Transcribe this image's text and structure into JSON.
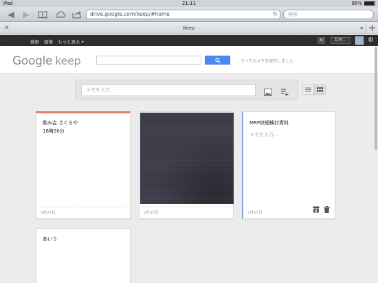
{
  "status_bar": {
    "carrier": "iPad",
    "time": "21:11",
    "battery": "98%"
  },
  "safari": {
    "url": "drive.google.com/keep/#home",
    "search_placeholder": "検索"
  },
  "tab": {
    "title": "Keep"
  },
  "google_bar": {
    "links": [
      "検索",
      "画像",
      "もっと見る ▾"
    ],
    "count": "9",
    "share_label": "共有..."
  },
  "keep_header": {
    "logo_google": "Google",
    "logo_keep": "keep",
    "saved_status": "すべてのメモを保存しました"
  },
  "note_input": {
    "placeholder": "メモを入力..."
  },
  "notes": [
    {
      "lines": [
        "飲み会 さくらや",
        "18時30分"
      ],
      "date": "3月25日",
      "color": "#e07c5f"
    },
    {
      "type": "image",
      "date": "3月25日"
    },
    {
      "title": "MRP詳細検討資料",
      "placeholder": "メモを入力...",
      "date": "3月25日"
    },
    {
      "lines": [
        "あいう"
      ]
    }
  ]
}
